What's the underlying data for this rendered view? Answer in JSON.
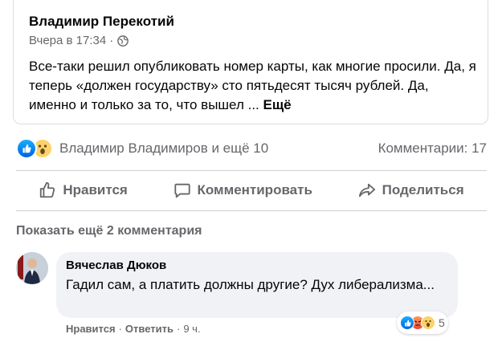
{
  "post": {
    "author": "Владимир Перекотий",
    "time": "Вчера в 17:34",
    "text": "Все-таки решил опубликовать номер карты, как многие просили. Да, я теперь «должен государству» сто пятьдесят тысяч рублей. Да, именно и только за то, что вышел ...",
    "more_label": "Ещё"
  },
  "reactions": {
    "names": "Владимир Владимиров и ещё 10",
    "comments_count": "Комментарии: 17"
  },
  "actions": {
    "like": "Нравится",
    "comment": "Комментировать",
    "share": "Поделиться"
  },
  "comments_section": {
    "show_more": "Показать ещё 2 комментария"
  },
  "comment": {
    "author": "Вячеслав Дюков",
    "text": "Гадил сам, а платить должны другие? Дух либерализма...",
    "reaction_count": "5",
    "like_label": "Нравится",
    "reply_label": "Ответить",
    "time": "9 ч."
  },
  "colors": {
    "secondary_text": "#65676b",
    "like_blue": "#1877f2",
    "bubble_bg": "#f0f2f5"
  }
}
